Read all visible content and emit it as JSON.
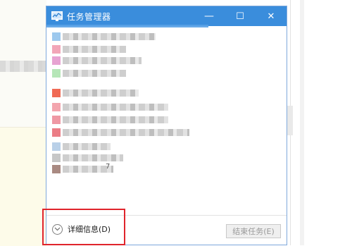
{
  "window": {
    "title": "任务管理器",
    "minimize_glyph": "—",
    "maximize_glyph": "☐",
    "close_glyph": "✕"
  },
  "process_list": {
    "items": [
      {
        "icon_color": "#9ec9ee"
      },
      {
        "icon_color": "#f2a6b8"
      },
      {
        "icon_color": "#e7a3d2"
      },
      {
        "icon_color": "#b6e6b8"
      },
      {
        "icon_color": "#f06a55"
      },
      {
        "icon_color": "#f3a5ae"
      },
      {
        "icon_color": "#ef98a4"
      },
      {
        "icon_color": "#eb7d86"
      },
      {
        "icon_color": "#b9d0e8"
      },
      {
        "icon_color": "#c7c7c7"
      },
      {
        "icon_color": "#a98a82"
      }
    ],
    "last_item_suffix": "7"
  },
  "footer": {
    "details_label": "详细信息(D)",
    "end_task_label": "结束任务(E)"
  },
  "colors": {
    "titlebar": "#3a8ddc",
    "highlight": "#e0242c"
  }
}
